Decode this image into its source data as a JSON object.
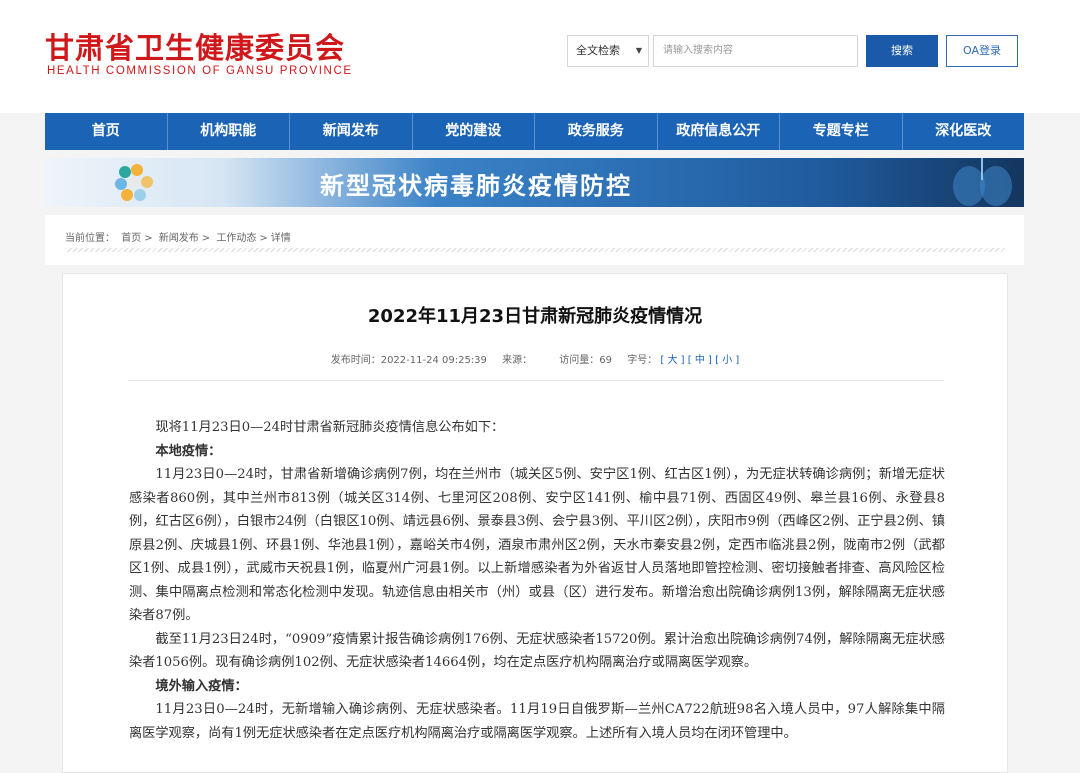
{
  "header": {
    "logo_cn": "甘肃省卫生健康委员会",
    "logo_en": "HEALTH COMMISSION OF GANSU PROVINCE",
    "search_scope": "全文检索",
    "search_placeholder": "请输入搜索内容",
    "search_button": "搜索",
    "oa_button": "OA登录"
  },
  "nav": {
    "items": [
      "首页",
      "机构职能",
      "新闻发布",
      "党的建设",
      "政务服务",
      "政府信息公开",
      "专题专栏",
      "深化医改"
    ]
  },
  "banner": {
    "title": "新型冠状病毒肺炎疫情防控"
  },
  "breadcrumb": {
    "label": "当前位置：",
    "items": [
      "首页",
      "新闻发布",
      "工作动态",
      "详情"
    ],
    "sep": ">"
  },
  "article": {
    "title": "2022年11月23日甘肃新冠肺炎疫情情况",
    "meta": {
      "publish_label": "发布时间：",
      "publish_time": "2022-11-24 09:25:39",
      "source_label": "来源：",
      "source": "",
      "views_label": "访问量：",
      "views": "69",
      "font_label": "字号：",
      "size_large": "大",
      "size_medium": "中",
      "size_small": "小"
    },
    "paragraphs": [
      "现将11月23日0—24时甘肃省新冠肺炎疫情信息公布如下：",
      "本地疫情：",
      "11月23日0—24时，甘肃省新增确诊病例7例，均在兰州市（城关区5例、安宁区1例、红古区1例），为无症状转确诊病例；新增无症状感染者860例，其中兰州市813例（城关区314例、七里河区208例、安宁区141例、榆中县71例、西固区49例、皋兰县16例、永登县8例，红古区6例），白银市24例（白银区10例、靖远县6例、景泰县3例、会宁县3例、平川区2例），庆阳市9例（西峰区2例、正宁县2例、镇原县2例、庆城县1例、环县1例、华池县1例），嘉峪关市4例，酒泉市肃州区2例，天水市秦安县2例，定西市临洮县2例，陇南市2例（武都区1例、成县1例），武威市天祝县1例，临夏州广河县1例。以上新增感染者为外省返甘人员落地即管控检测、密切接触者排查、高风险区检测、集中隔离点检测和常态化检测中发现。轨迹信息由相关市（州）或县（区）进行发布。新增治愈出院确诊病例13例，解除隔离无症状感染者87例。",
      "截至11月23日24时，“0909”疫情累计报告确诊病例176例、无症状感染者15720例。累计治愈出院确诊病例74例，解除隔离无症状感染者1056例。现有确诊病例102例、无症状感染者14664例，均在定点医疗机构隔离治疗或隔离医学观察。",
      "境外输入疫情：",
      "11月23日0—24时，无新增输入确诊病例、无症状感染者。11月19日自俄罗斯—兰州CA722航班98名入境人员中，97人解除集中隔离医学观察，尚有1例无症状感染者在定点医疗机构隔离治疗或隔离医学观察。上述所有入境人员均在闭环管理中。"
    ]
  },
  "colors": {
    "brand_red": "#d0181b",
    "nav_blue": "#1b63b5",
    "button_blue": "#1a5aa8"
  }
}
